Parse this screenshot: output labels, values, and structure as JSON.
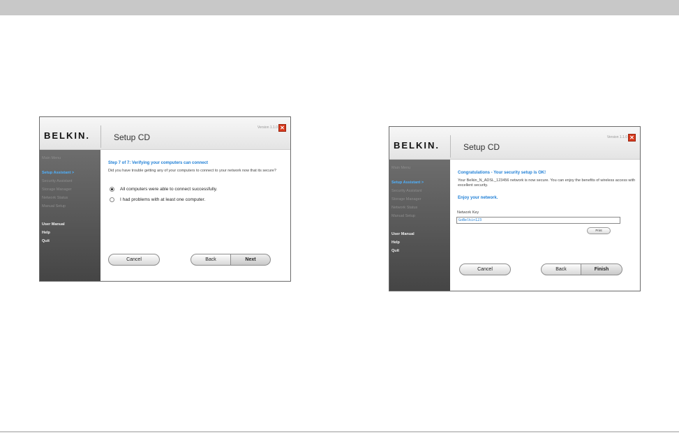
{
  "windows": [
    {
      "logo": "BELKIN.",
      "title": "Setup CD",
      "version": "Version 1.1.0",
      "sidebar": [
        "Main Menu",
        "Setup Assistant  >",
        "Security Assistant",
        "Storage Manager",
        "Network Status",
        "Manual Setup",
        "User Manual",
        "Help",
        "Quit"
      ],
      "step_title": "Step 7 of 7: Verifying your computers can connect",
      "description": "Did you have trouble getting any of your computers to connect to your network now that its secure?",
      "options": [
        {
          "label": "All computers were able to connect successfully.",
          "selected": true
        },
        {
          "label": "I had problems with at least one computer.",
          "selected": false
        }
      ],
      "buttons": {
        "cancel": "Cancel",
        "back": "Back",
        "next": "Next"
      }
    },
    {
      "logo": "BELKIN.",
      "title": "Setup CD",
      "version": "Version 1.1.0",
      "sidebar": [
        "Main Menu",
        "Setup Assistant  >",
        "Security Assistant",
        "Storage Manager",
        "Network Status",
        "Manual Setup",
        "User Manual",
        "Help",
        "Quit"
      ],
      "congrats": "Congratulations - Your security setup is OK!",
      "description": "Your Belkin_N_ADSL_123456 network is now secure. You can enjoy the benefits of wireless access with excellent security.",
      "enjoy": "Enjoy your network.",
      "key_label": "Network Key",
      "key_value": "GoBelkin123",
      "print": "Print",
      "buttons": {
        "cancel": "Cancel",
        "back": "Back",
        "finish": "Finish"
      }
    }
  ]
}
